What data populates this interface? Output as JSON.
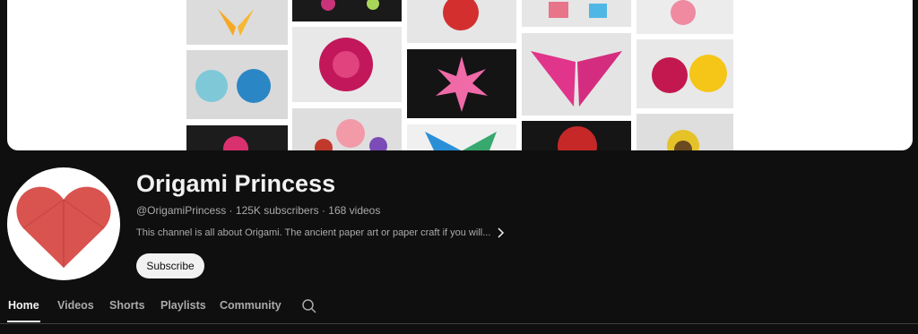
{
  "channel": {
    "name": "Origami Princess",
    "handle": "@OrigamiPrincess",
    "subscribers": "125K subscribers",
    "videos": "168 videos",
    "separator": "·",
    "description": "This channel is all about Origami. The ancient paper art or paper craft if you will..."
  },
  "actions": {
    "subscribe_label": "Subscribe"
  },
  "tabs": [
    {
      "label": "Home",
      "active": true
    },
    {
      "label": "Videos",
      "active": false
    },
    {
      "label": "Shorts",
      "active": false
    },
    {
      "label": "Playlists",
      "active": false
    },
    {
      "label": "Community",
      "active": false
    }
  ],
  "icons": {
    "search": "search-icon",
    "more": "chevron-right-icon"
  },
  "colors": {
    "background": "#0f0f0f",
    "text": "#f1f1f1",
    "secondary_text": "#aaaaaa",
    "heart": "#d9534f"
  }
}
